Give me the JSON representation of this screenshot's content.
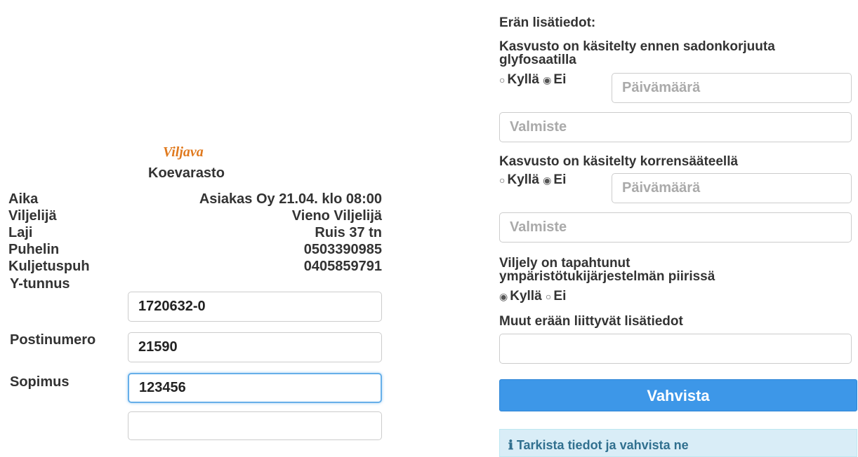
{
  "logo": "Viljava",
  "storage_title": "Koevarasto",
  "info": [
    {
      "label": "Aika",
      "value": "Asiakas Oy 21.04. klo 08:00"
    },
    {
      "label": "Viljelijä",
      "value": "Vieno Viljelijä"
    },
    {
      "label": "Laji",
      "value": "Ruis 37 tn"
    },
    {
      "label": "Puhelin",
      "value": "0503390985"
    },
    {
      "label": "Kuljetuspuh",
      "value": "0405859791"
    }
  ],
  "fields": {
    "ytunnus": {
      "label": "Y-tunnus",
      "value": "1720632-0"
    },
    "postinumero": {
      "label": "Postinumero",
      "value": "21590"
    },
    "sopimus": {
      "label": "Sopimus",
      "value": "123456"
    },
    "extra": {
      "value": ""
    }
  },
  "right": {
    "heading": "Erän lisätiedot:",
    "glyfosaatti": {
      "question_line1": "Kasvusto on käsitelty ennen sadonkorjuuta",
      "question_line2": "glyfosaatilla",
      "yes": "Kyllä",
      "no": "Ei",
      "selected": "Ei",
      "date_placeholder": "Päivämäärä",
      "product_placeholder": "Valmiste"
    },
    "korrensaade": {
      "question": "Kasvusto on käsitelty korrensääteellä",
      "yes": "Kyllä",
      "no": "Ei",
      "selected": "Ei",
      "date_placeholder": "Päivämäärä",
      "product_placeholder": "Valmiste"
    },
    "ymparisto": {
      "question_line1": "Viljely on tapahtunut",
      "question_line2": "ympäristötukijärjestelmän piirissä",
      "yes": "Kyllä",
      "no": "Ei",
      "selected": "Kyllä"
    },
    "muut": {
      "label": "Muut erään liittyvät lisätiedot",
      "value": ""
    },
    "confirm_button": "Vahvista",
    "alert_text": "Tarkista tiedot ja vahvista ne"
  },
  "colors": {
    "primary": "#3d97e8",
    "logo": "#e07a1f",
    "alert_bg": "#d9edf7"
  }
}
